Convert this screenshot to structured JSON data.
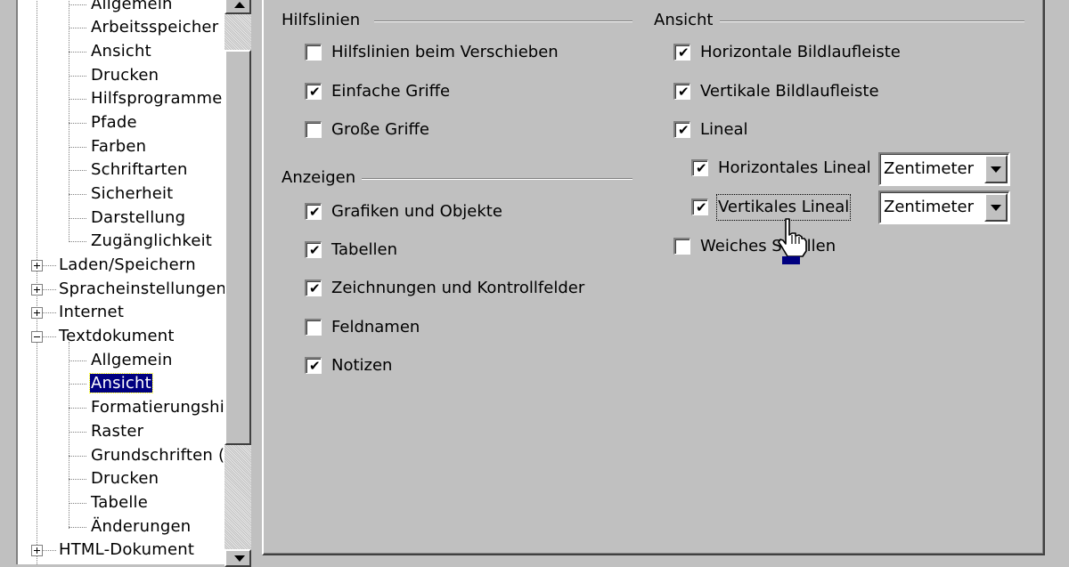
{
  "tree": {
    "items": [
      {
        "label": "Allgemein"
      },
      {
        "label": "Arbeitsspeicher"
      },
      {
        "label": "Ansicht"
      },
      {
        "label": "Drucken"
      },
      {
        "label": "Hilfsprogramme"
      },
      {
        "label": "Pfade"
      },
      {
        "label": "Farben"
      },
      {
        "label": "Schriftarten"
      },
      {
        "label": "Sicherheit"
      },
      {
        "label": "Darstellung"
      },
      {
        "label": "Zugänglichkeit"
      },
      {
        "label": "Laden/Speichern"
      },
      {
        "label": "Spracheinstellungen"
      },
      {
        "label": "Internet"
      },
      {
        "label": "Textdokument"
      },
      {
        "label": "Allgemein"
      },
      {
        "label": "Ansicht"
      },
      {
        "label": "Formatierungshilfe"
      },
      {
        "label": "Raster"
      },
      {
        "label": "Grundschriften (w"
      },
      {
        "label": "Drucken"
      },
      {
        "label": "Tabelle"
      },
      {
        "label": "Änderungen"
      },
      {
        "label": "HTML-Dokument"
      }
    ]
  },
  "hilfslinien": {
    "title": "Hilfslinien",
    "items": [
      {
        "label": "Hilfslinien beim Verschieben",
        "checked": false
      },
      {
        "label": "Einfache Griffe",
        "checked": true
      },
      {
        "label": "Große Griffe",
        "checked": false
      }
    ]
  },
  "anzeigen": {
    "title": "Anzeigen",
    "items": [
      {
        "label": "Grafiken und Objekte",
        "checked": true
      },
      {
        "label": "Tabellen",
        "checked": true
      },
      {
        "label": "Zeichnungen und Kontrollfelder",
        "checked": true
      },
      {
        "label": "Feldnamen",
        "checked": false
      },
      {
        "label": "Notizen",
        "checked": true
      }
    ]
  },
  "ansicht": {
    "title": "Ansicht",
    "items": [
      {
        "label": "Horizontale Bildlaufleiste",
        "checked": true
      },
      {
        "label": "Vertikale Bildlaufleiste",
        "checked": true
      },
      {
        "label": "Lineal",
        "checked": true
      },
      {
        "label": "Horizontales Lineal",
        "checked": true,
        "unit": "Zentimeter"
      },
      {
        "label": "Vertikales Lineal",
        "checked": true,
        "unit": "Zentimeter"
      },
      {
        "label": "Weiches Scrollen",
        "checked": false
      }
    ]
  },
  "checkmark": "✔"
}
